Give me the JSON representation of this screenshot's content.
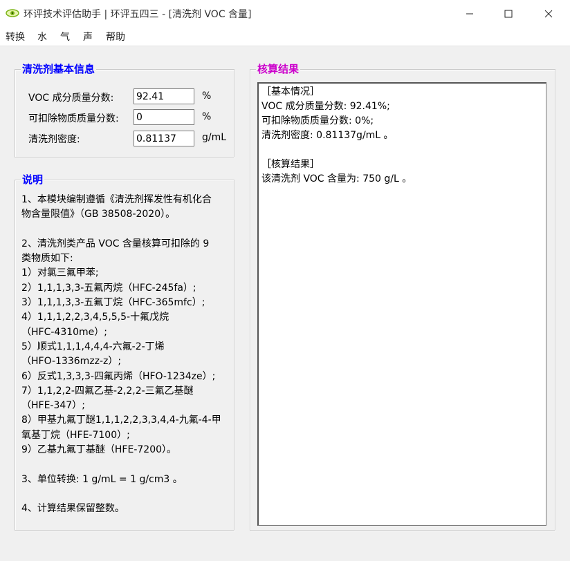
{
  "window": {
    "title": "环评技术评估助手 | 环评五四三 - [清洗剂 VOC 含量]",
    "minimize": "—",
    "maximize": "☐",
    "close": "✕"
  },
  "menu": [
    "转换",
    "水",
    "气",
    "声",
    "帮助"
  ],
  "basic_info": {
    "title": "清洗剂基本信息",
    "title_color": "#0000ff",
    "fields": [
      {
        "label": "VOC 成分质量分数:",
        "value": "92.41",
        "unit": "%"
      },
      {
        "label": "可扣除物质质量分数:",
        "value": "0",
        "unit": "%"
      },
      {
        "label": "清洗剂密度:",
        "value": "0.81137",
        "unit": "g/mL"
      }
    ]
  },
  "notes": {
    "title": "说明",
    "title_color": "#0000ff",
    "lines": [
      "1、本模块编制遵循《清洗剂挥发性有机化合",
      "物含量限值》（GB 38508-2020）。",
      "",
      "2、清洗剂类产品 VOC 含量核算可扣除的 9",
      "类物质如下:",
      "1）对氯三氟甲苯;",
      "2）1,1,1,3,3-五氟丙烷（HFC-245fa）;",
      "3）1,1,1,3,3-五氟丁烷（HFC-365mfc）;",
      "4）1,1,1,2,2,3,4,5,5,5-十氟戊烷",
      "（HFC-4310me）;",
      "5）顺式1,1,1,4,4,4-六氟-2-丁烯",
      "（HFO-1336mzz-z）;",
      "6）反式1,3,3,3-四氟丙烯（HFO-1234ze）;",
      "7）1,1,2,2-四氟乙基-2,2,2-三氟乙基醚",
      "（HFE-347）;",
      "8）甲基九氟丁醚1,1,1,2,2,3,3,4,4-九氟-4-甲",
      "氧基丁烷（HFE-7100）;",
      "9）乙基九氟丁基醚（HFE-7200）。",
      "",
      "3、单位转换: 1 g/mL = 1 g/cm3 。",
      "",
      "4、计算结果保留整数。"
    ]
  },
  "results": {
    "title": "核算结果",
    "title_color": "#cc00cc",
    "lines": [
      "［基本情况］",
      "VOC 成分质量分数: 92.41%;",
      "可扣除物质质量分数: 0%;",
      "清洗剂密度: 0.81137g/mL 。",
      "",
      "［核算结果］",
      "该清洗剂 VOC 含量为: 750 g/L 。"
    ]
  }
}
